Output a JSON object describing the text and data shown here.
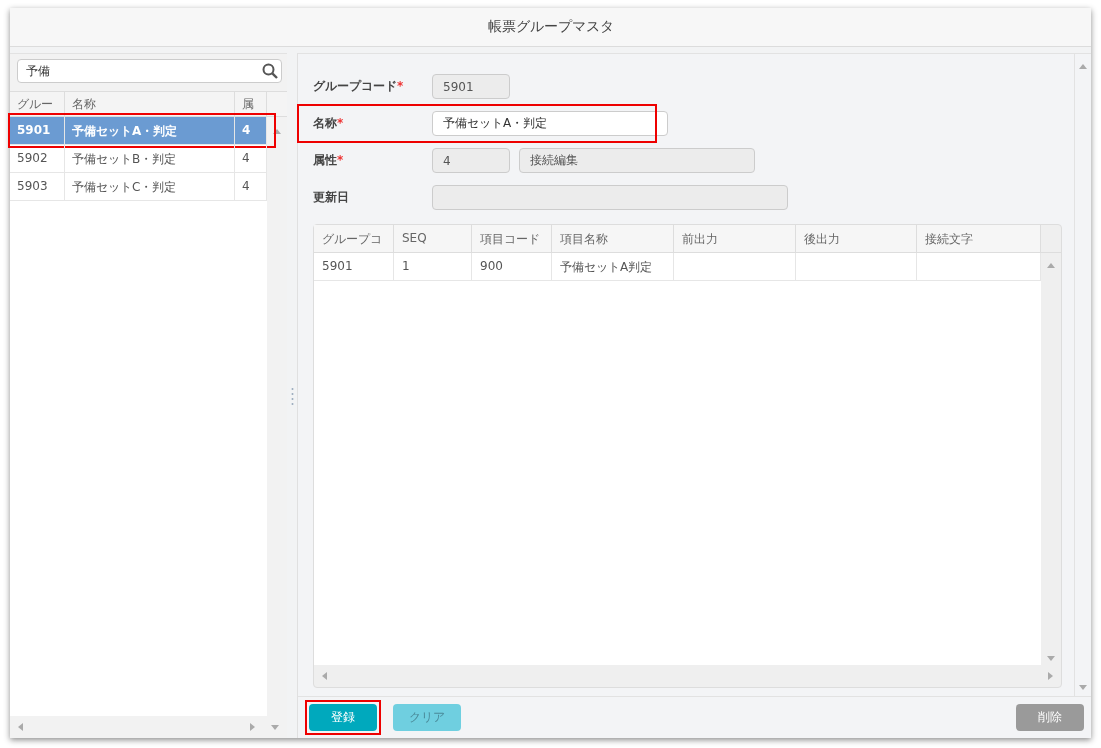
{
  "window": {
    "title": "帳票グループマスタ"
  },
  "search": {
    "value": "予備"
  },
  "list": {
    "columns": [
      "グルー",
      "名称",
      "属"
    ],
    "rows": [
      {
        "cells": [
          "5901",
          "予備セットA・判定",
          "4"
        ],
        "selected": true,
        "highlighted": true
      },
      {
        "cells": [
          "5902",
          "予備セットB・判定",
          "4"
        ],
        "selected": false,
        "highlighted": false
      },
      {
        "cells": [
          "5903",
          "予備セットC・判定",
          "4"
        ],
        "selected": false,
        "highlighted": false
      }
    ]
  },
  "form": [
    {
      "label": "グループコード",
      "required": true,
      "highlighted": false,
      "fields": [
        {
          "value": "5901",
          "kind": "short",
          "disabled": true
        }
      ]
    },
    {
      "label": "名称",
      "required": true,
      "highlighted": true,
      "fields": [
        {
          "value": "予備セットA・判定",
          "kind": "medium",
          "disabled": false
        }
      ]
    },
    {
      "label": "属性",
      "required": true,
      "highlighted": false,
      "fields": [
        {
          "value": "4",
          "kind": "short",
          "disabled": true
        },
        {
          "value": "接続編集",
          "kind": "medium",
          "disabled": true
        }
      ]
    },
    {
      "label": "更新日",
      "required": false,
      "highlighted": false,
      "fields": [
        {
          "kind": "long",
          "disabled": true
        }
      ]
    }
  ],
  "required_mark": "*",
  "table": {
    "columns": [
      "グループコ",
      "SEQ",
      "項目コード",
      "項目名称",
      "前出力",
      "後出力",
      "接続文字"
    ],
    "rows": [
      [
        "5901",
        "1",
        "900",
        "予備セットA判定",
        "",
        "",
        ""
      ]
    ]
  },
  "buttons": [
    {
      "label": "登録",
      "kind": "primary",
      "highlighted": true
    },
    {
      "label": "クリア",
      "kind": "secondary",
      "highlighted": false
    },
    {
      "label": "削除",
      "kind": "danger",
      "highlighted": false
    }
  ]
}
